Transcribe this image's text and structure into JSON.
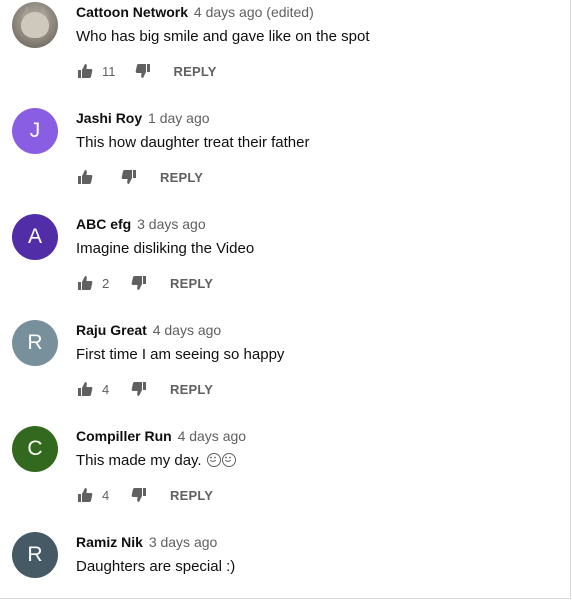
{
  "comments": [
    {
      "author": "Cattoon Network",
      "time": "4 days ago (edited)",
      "text": "Who has big smile and gave like on the spot",
      "likes": "11",
      "reply": "REPLY",
      "avatar": {
        "type": "photo",
        "icon": "cat-photo-avatar"
      }
    },
    {
      "author": "Jashi Roy",
      "time": "1 day ago",
      "text": "This how daughter treat their father",
      "likes": "",
      "reply": "REPLY",
      "avatar": {
        "type": "letter",
        "letter": "J",
        "color": "#8a5ee2"
      }
    },
    {
      "author": "ABC efg",
      "time": "3 days ago",
      "text": "Imagine disliking the Video",
      "likes": "2",
      "reply": "REPLY",
      "avatar": {
        "type": "letter",
        "letter": "A",
        "color": "#512da8"
      }
    },
    {
      "author": "Raju Great",
      "time": "4 days ago",
      "text": "First time I am seeing so happy",
      "likes": "4",
      "reply": "REPLY",
      "avatar": {
        "type": "letter",
        "letter": "R",
        "color": "#78909c"
      }
    },
    {
      "author": "Compiller Run",
      "time": "4 days ago",
      "text": "This made my day. ",
      "emoji_count": 2,
      "likes": "4",
      "reply": "REPLY",
      "avatar": {
        "type": "letter",
        "letter": "C",
        "color": "#33691e"
      }
    },
    {
      "author": "Ramiz Nik",
      "time": "3 days ago",
      "text": "Daughters are special :)",
      "likes": "",
      "reply": "",
      "avatar": {
        "type": "letter",
        "letter": "R",
        "color": "#455a64"
      }
    }
  ],
  "icons": {
    "like": "thumbs-up-icon",
    "dislike": "thumbs-down-icon",
    "emoji": "smiley-icon"
  }
}
